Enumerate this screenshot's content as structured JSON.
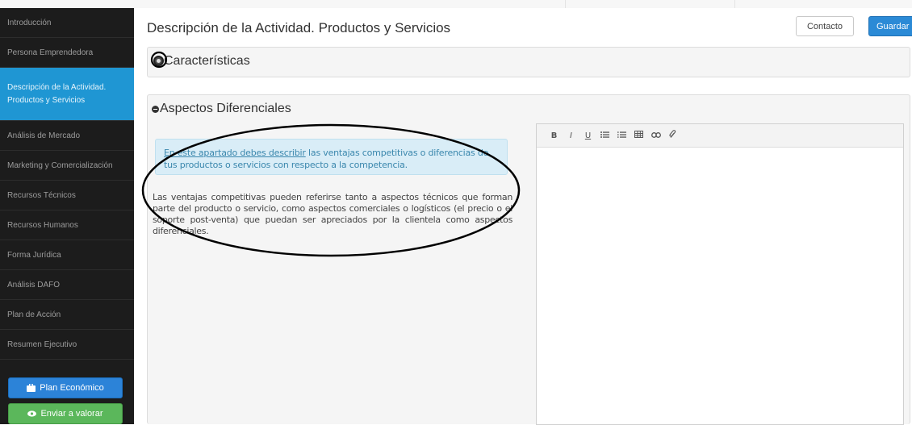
{
  "sidebar": {
    "items": [
      {
        "label": "Introducción"
      },
      {
        "label": "Persona Emprendedora"
      },
      {
        "label_line1": "Descripción de la Actividad.",
        "label_line2": "Productos y Servicios"
      },
      {
        "label": "Análisis de Mercado"
      },
      {
        "label": "Marketing y Comercialización"
      },
      {
        "label": "Recursos Técnicos"
      },
      {
        "label": "Recursos Humanos"
      },
      {
        "label": "Forma Jurídica"
      },
      {
        "label": "Análisis DAFO"
      },
      {
        "label": "Plan de Acción"
      },
      {
        "label": "Resumen Ejecutivo"
      }
    ],
    "plan_button": "Plan Económico",
    "send_button": "Enviar a valorar"
  },
  "header": {
    "title": "Descripción de la Actividad. Productos y Servicios",
    "contacto": "Contacto",
    "guardar": "Guardar"
  },
  "sections": {
    "caracteristicas": "Características",
    "aspectos": "Aspectos Diferenciales"
  },
  "info": {
    "link": "En este apartado debes describir",
    "rest": " las ventajas competitivas o diferencias de tus productos o servicios con respecto a la competencia."
  },
  "description": "Las ventajas competitivas pueden referirse tanto a aspectos técnicos que forman parte del producto o servicio, como aspectos comerciales o logísticos (el precio o el soporte post-venta) que puedan ser apreciados por la clientela como aspectos diferenciales.",
  "toolbar": {
    "bold": "B",
    "italic": "I",
    "underline": "U"
  },
  "colors": {
    "sidebar_bg": "#1c1c1c",
    "active_item": "#1f96d3",
    "primary_button": "#2b8ad6",
    "success_button": "#5bb75b",
    "info_bg": "#d9edf7",
    "info_text": "#3a87ad"
  }
}
